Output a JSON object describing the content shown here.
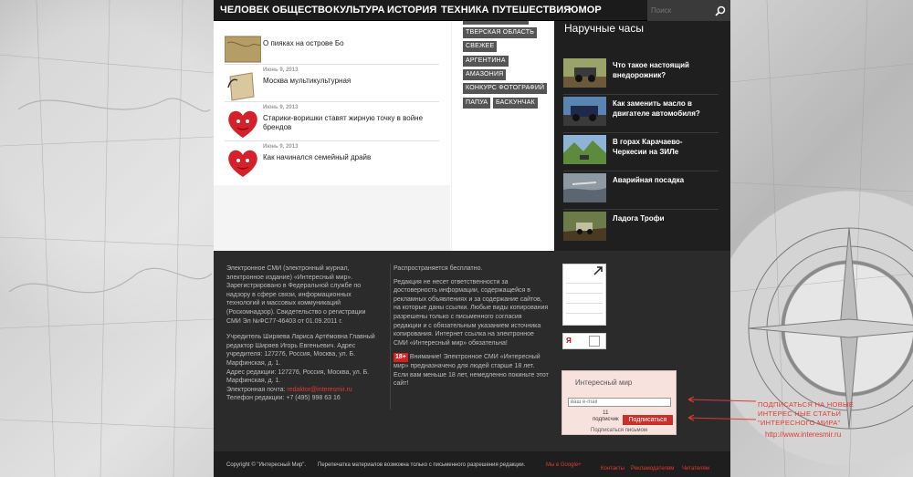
{
  "nav": {
    "items": [
      "ЧЕЛОВЕК",
      "ОБЩЕСТВО",
      "КУЛЬТУРА",
      "ИСТОРИЯ",
      "ТЕХНИКА",
      "ПУТЕШЕСТВИЯ",
      "ЮМОР"
    ],
    "search_placeholder": "Поиск"
  },
  "posts": [
    {
      "date": "Июнь 9, 2013",
      "title": "О пияках на острове Бо",
      "thumb": "map-thumbnail"
    },
    {
      "date": "Июнь 9, 2013",
      "title": "Москва мультикультурная",
      "thumb": "paper-thumbnail"
    },
    {
      "date": "Июнь 9, 2013",
      "title": "Старики-воришки ставят жирную точку в войне брендов",
      "thumb": "heart-thumbnail"
    },
    {
      "date": "Июнь 9, 2013",
      "title": "Как начинался семейный драйв",
      "thumb": "heart-thumbnail"
    }
  ],
  "tags": [
    "ТВЕРСКАЯ ОБЛАСТЬ",
    "СВЕЖЕЕ",
    "АРГЕНТИНА",
    "АМАЗОНИЯ",
    "КОНКУРС ФОТОГРАФИЙ",
    "ПАПУА",
    "БАСКУНЧАК"
  ],
  "sidebar": {
    "title": "Наручные часы",
    "posts": [
      {
        "title": "Что такое настоящий внедорожник?"
      },
      {
        "title": "Как заменить масло в двигателе автомобиля?"
      },
      {
        "title": "В горах Карачаево-Черкесии на ЗИЛе"
      },
      {
        "title": "Аварийная посадка"
      },
      {
        "title": "Ладога Трофи"
      }
    ]
  },
  "footer": {
    "col1_p1": "Электронное СМИ (электронный журнал, электронное издание) «Интересный мир». Зарегистрировано в Федеральной службе по надзору в сфере связи, информационных технологий и массовых коммуникаций (Роскомнадзор). Свидетельство о регистрации СМИ Эл №ФС77-46403 от 01.09.2011 г.",
    "col1_p2": "Учредитель Ширяева Лариса Артёмовна Главный редактор Ширяев Игорь Евгеньевич. Адрес учредителя: 127276, Россия, Москва, ул. Б. Марфинская, д. 1.",
    "col1_p3": "Адрес редакции: 127276, Россия, Москва, ул. Б. Марфинская, д. 1.",
    "col1_email_label": "Электронная почта:",
    "col1_email": "redaktor@interesmir.ru",
    "col1_phone": "Телефон редакции: +7 (495) 998 63 16",
    "col2_p1": "Распространяется бесплатно.",
    "col2_p2": "Редакция не несет ответственности за достоверность информации, содержащейся в рекламных объявлениях и за содержание сайтов, на которые даны ссылки. Любые виды копирования разрешены только с письменного согласия редакции и с обязательным указанием источника копирования. Интернет ссылка на электронное СМИ «Интересный мир» обязательна!",
    "col2_badge": "18+",
    "col2_p3": "Внимание! Электронное СМИ «Интересный мир» предназначено для людей старше 18 лет. Если вам меньше 18 лет, немедленно покиньте этот сайт!"
  },
  "subscribe": {
    "title": "Интересный мир",
    "email_placeholder": "ваш e-mail",
    "count": "11",
    "count_label": "подписчик",
    "button": "Подписаться",
    "footer": "Подписаться письмом"
  },
  "bottom": {
    "copyright": "Copyright © \"Интересный Мир\".",
    "notice": "Перепечатка материалов возможна только с письменного разрешения редакции.",
    "google": "Мы в Google+",
    "links": [
      "Контакты",
      "Рекламодателям",
      "Читателям"
    ]
  },
  "annotation": {
    "text": "ПОДПИСАТЬСЯ НА НОВЫЕ ИНТЕРЕС НЫЕ СТАТЬИ \"ИНТЕРЕСНОГО МИРА\"",
    "link": "http://www.interesmir.ru"
  },
  "colors": {
    "accent": "#e23a2e",
    "nav_bg": "#1b1b1b",
    "footer_bg": "#2b2b2b"
  }
}
